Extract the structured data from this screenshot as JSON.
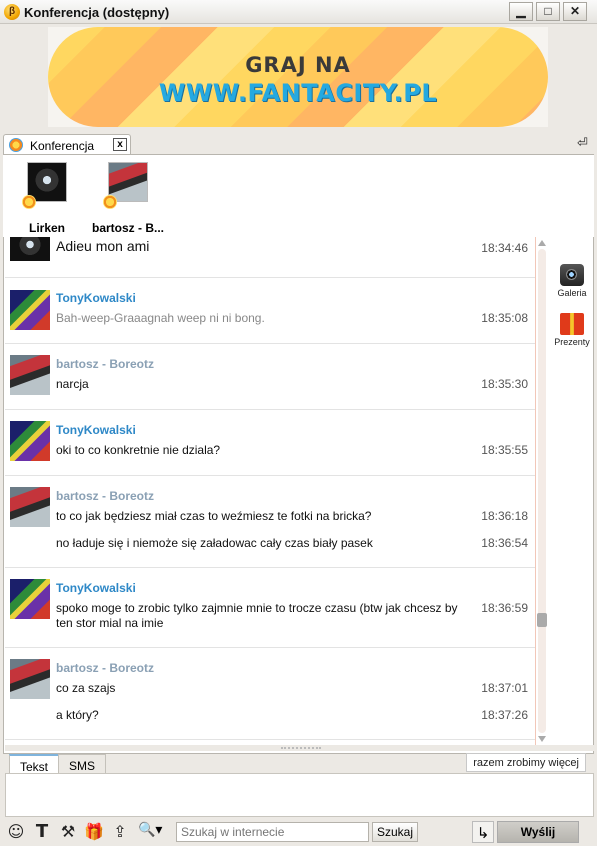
{
  "window": {
    "title": "Konferencja (dostępny)",
    "app_icon": "β",
    "minimize": "▁",
    "maximize": "□",
    "close": "✕"
  },
  "banner": {
    "line1": "GRAJ NA",
    "line2": "WWW.FANTACITY.PL"
  },
  "tab": {
    "label": "Konferencja",
    "close": "x"
  },
  "participants": [
    {
      "name": "Lirken"
    },
    {
      "name": "bartosz - B..."
    }
  ],
  "messages": [
    {
      "sender": "",
      "lines": [
        {
          "text": "Adieu mon ami",
          "time": "18:34:46"
        }
      ]
    },
    {
      "sender": "TonyKowalski",
      "lines": [
        {
          "text": "Bah-weep-Graaagnah weep ni ni bong.",
          "time": "18:35:08"
        }
      ]
    },
    {
      "sender": "bartosz - Boreotz",
      "lines": [
        {
          "text": "narcja",
          "time": "18:35:30"
        }
      ]
    },
    {
      "sender": "TonyKowalski",
      "lines": [
        {
          "text": "oki to co konkretnie nie dziala?",
          "time": "18:35:55"
        }
      ]
    },
    {
      "sender": "bartosz - Boreotz",
      "lines": [
        {
          "text": "to co jak będziesz miał czas to weźmiesz te fotki na bricka?",
          "time": "18:36:18"
        },
        {
          "text": "no ładuje się i niemoże się załadowac cały czas biały pasek",
          "time": "18:36:54"
        }
      ]
    },
    {
      "sender": "TonyKowalski",
      "lines": [
        {
          "text": "spoko moge to zrobic tylko zajmnie mnie to trocze czasu (btw jak chcesz by ten stor mial na imie",
          "time": "18:36:59"
        }
      ]
    },
    {
      "sender": "bartosz - Boreotz",
      "lines": [
        {
          "text": "co za szajs",
          "time": "18:37:01"
        },
        {
          "text": "a który?",
          "time": "18:37:26"
        }
      ]
    }
  ],
  "side_tools": {
    "gallery": "Galeria",
    "gifts": "Prezenty"
  },
  "input": {
    "tab_text": "Tekst",
    "tab_sms": "SMS",
    "typing_note": "razem zrobimy więcej"
  },
  "toolbar": {
    "search_placeholder": "Szukaj w internecie",
    "search_button": "Szukaj",
    "send_button": "Wyślij"
  }
}
